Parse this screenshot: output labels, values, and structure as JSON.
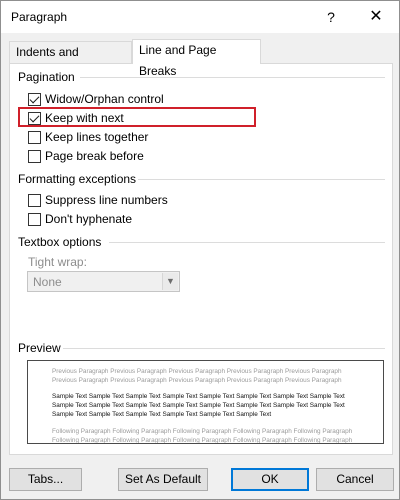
{
  "window": {
    "title": "Paragraph",
    "help_glyph": "?",
    "close_glyph": "✕"
  },
  "tabs": [
    {
      "label": "Indents and Spacing",
      "active": false
    },
    {
      "label": "Line and Page Breaks",
      "active": true
    }
  ],
  "pagination": {
    "heading": "Pagination",
    "options": [
      {
        "label": "Widow/Orphan control",
        "checked": true
      },
      {
        "label": "Keep with next",
        "checked": true,
        "highlighted": true
      },
      {
        "label": "Keep lines together",
        "checked": false
      },
      {
        "label": "Page break before",
        "checked": false
      }
    ]
  },
  "formatting": {
    "heading": "Formatting exceptions",
    "options": [
      {
        "label": "Suppress line numbers",
        "checked": false
      },
      {
        "label": "Don't hyphenate",
        "checked": false
      }
    ]
  },
  "textbox": {
    "heading": "Textbox options",
    "tight_wrap_label": "Tight wrap:",
    "tight_wrap_value": "None"
  },
  "preview": {
    "heading": "Preview",
    "previous_text": "Previous Paragraph Previous Paragraph Previous Paragraph Previous Paragraph Previous Paragraph Previous Paragraph Previous Paragraph Previous Paragraph Previous Paragraph Previous Paragraph",
    "sample_text": "Sample Text Sample Text Sample Text Sample Text Sample Text Sample Text Sample Text Sample Text Sample Text Sample Text Sample Text Sample Text Sample Text Sample Text Sample Text Sample Text Sample Text Sample Text Sample Text Sample Text Sample Text Sample Text",
    "following_text": "Following Paragraph Following Paragraph Following Paragraph Following Paragraph Following Paragraph Following Paragraph Following Paragraph Following Paragraph Following Paragraph Following Paragraph"
  },
  "buttons": {
    "tabs": "Tabs...",
    "set_default": "Set As Default",
    "ok": "OK",
    "cancel": "Cancel"
  },
  "colors": {
    "highlight": "#d0202a",
    "ok_focus": "#0078d7"
  }
}
